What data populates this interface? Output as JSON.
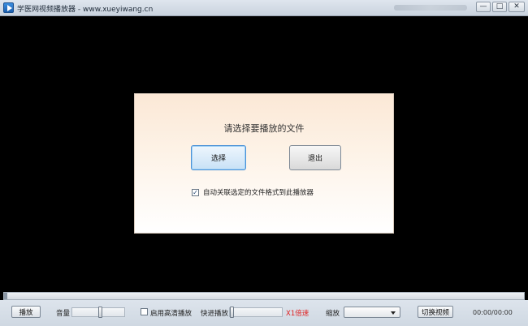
{
  "window": {
    "title": "学医网视频播放器 - www.xueyiwang.cn",
    "icon": "play-icon",
    "controls": {
      "minimize": "—",
      "maximize": "□",
      "close": "✕"
    }
  },
  "dialog": {
    "title": "请选择要播放的文件",
    "select_label": "选择",
    "exit_label": "退出",
    "associate_label": "自动关联选定的文件格式到此播放器",
    "associate_checked": "✓"
  },
  "toolbar": {
    "play_label": "播放",
    "volume_label": "音量",
    "volume_level": 0.55,
    "hd_label": "启用高清播放",
    "fast_forward_label": "快进播放",
    "fast_forward_level": 0.0,
    "speed_value": "X1倍速",
    "zoom_label": "缩放",
    "zoom_value": "",
    "switch_video_label": "切换视频",
    "time": "00:00/00:00"
  },
  "seek": {
    "progress": 0.0
  },
  "colors": {
    "speed_value": "#e02020",
    "select_button_border": "#4a90d6"
  }
}
